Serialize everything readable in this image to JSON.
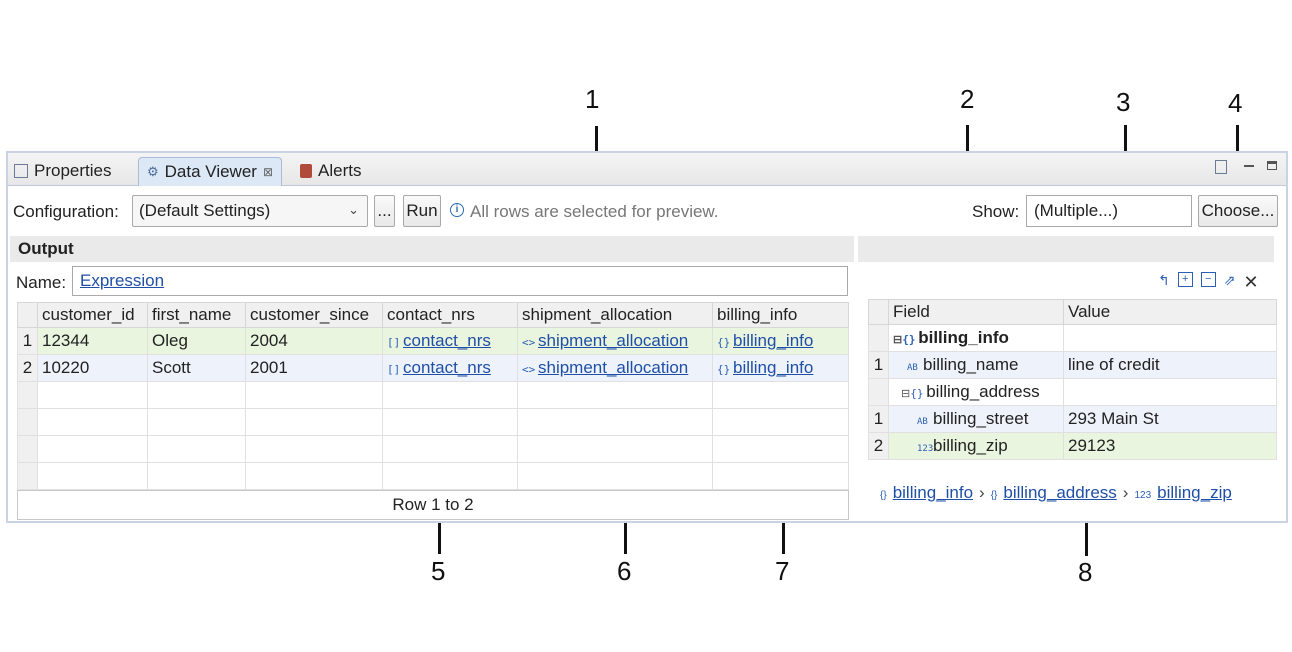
{
  "callouts": [
    "1",
    "2",
    "3",
    "4",
    "5",
    "6",
    "7",
    "8"
  ],
  "tabs": [
    {
      "label": "Properties",
      "icon": "properties-icon"
    },
    {
      "label": "Data Viewer",
      "icon": "data-viewer-icon",
      "close": "⊠"
    },
    {
      "label": "Alerts",
      "icon": "alerts-icon"
    }
  ],
  "toolbar": {
    "configuration_label": "Configuration:",
    "configuration_value": "(Default Settings)",
    "ellipsis_label": "...",
    "run_label": "Run",
    "info_text": "All rows are selected for preview.",
    "show_label": "Show:",
    "show_value": "(Multiple...)",
    "choose_label": "Choose..."
  },
  "output": {
    "title": "Output",
    "name_label": "Name:",
    "name_value": "Expression",
    "columns": [
      "customer_id",
      "first_name",
      "customer_since",
      "contact_nrs",
      "shipment_allocation",
      "billing_info"
    ],
    "rows": [
      {
        "n": "1",
        "customer_id": "12344",
        "first_name": "Oleg",
        "customer_since": "2004",
        "contact_nrs": "contact_nrs",
        "shipment_allocation": "shipment_allocation",
        "billing_info": "billing_info"
      },
      {
        "n": "2",
        "customer_id": "10220",
        "first_name": "Scott",
        "customer_since": "2001",
        "contact_nrs": "contact_nrs",
        "shipment_allocation": "shipment_allocation",
        "billing_info": "billing_info"
      }
    ],
    "footer": "Row 1 to 2"
  },
  "detail": {
    "columns": [
      "Field",
      "Value"
    ],
    "rows": [
      {
        "n": "",
        "field": "billing_info",
        "value": ""
      },
      {
        "n": "1",
        "field": "billing_name",
        "value": "line of credit"
      },
      {
        "n": "",
        "field": "billing_address",
        "value": ""
      },
      {
        "n": "1",
        "field": "billing_street",
        "value": "293 Main St"
      },
      {
        "n": "2",
        "field": "billing_zip",
        "value": "29123"
      }
    ],
    "breadcrumb": [
      "billing_info",
      "billing_address",
      "billing_zip"
    ]
  }
}
